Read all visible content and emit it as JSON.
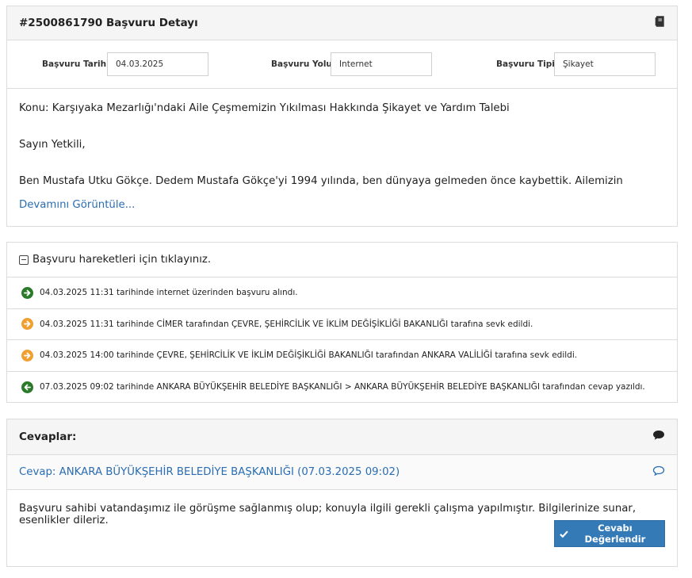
{
  "detail": {
    "title": "#2500861790 Başvuru Detayı",
    "fields": [
      {
        "label": "Başvuru Tarihi:",
        "value": "04.03.2025"
      },
      {
        "label": "Başvuru Yolu:",
        "value": "İnternet"
      },
      {
        "label": "Başvuru Tipi:",
        "value": "Şikayet"
      }
    ],
    "subject": "Konu: Karşıyaka Mezarlığı'ndaki Aile Çeşmemizin Yıkılması Hakkında Şikayet ve Yardım Talebi",
    "greeting": "Sayın Yetkili,",
    "body": "Ben Mustafa Utku Gökçe. Dedem Mustafa Gökçe'yi 1994 yılında, ben dünyaya gelmeden önce kaybettik. Ailemizin büyüklerinden halam Fahriye Gökçe de bu acıyı yaşamış ve aile çeşmemizin onarılmasını Karşıyaka Mezarlığı'nda istedik.",
    "more_link": "Devamını Görüntüle..."
  },
  "history": {
    "toggle_label": "Başvuru hareketleri için tıklayınız.",
    "items": [
      {
        "text": "04.03.2025 11:31 tarihinde internet üzerinden başvuru alındı.",
        "icon": "arrow-right-circle-icon",
        "color": "#2a7a2a"
      },
      {
        "text": "04.03.2025 11:31 tarihinde CİMER tarafından ÇEVRE, ŞEHİRCİLİK VE İKLİM DEĞİŞİKLİĞİ BAKANLIĞI tarafına sevk edildi.",
        "icon": "arrow-right-circle-icon",
        "color": "#f0a030"
      },
      {
        "text": "04.03.2025 14:00 tarihinde ÇEVRE, ŞEHİRCİLİK VE İKLİM DEĞİŞİKLİĞİ BAKANLIĞI tarafından ANKARA VALİLİĞİ tarafına sevk edildi.",
        "icon": "arrow-right-circle-icon",
        "color": "#f0a030"
      },
      {
        "text": "07.03.2025 09:02 tarihinde ANKARA BÜYÜKŞEHİR BELEDİYE BAŞKANLIĞI > ANKARA BÜYÜKŞEHİR BELEDİYE BAŞKANLIĞI tarafından cevap yazıldı.",
        "icon": "arrow-left-circle-icon",
        "color": "#2a7a2a"
      }
    ]
  },
  "answers": {
    "title": "Cevaplar:",
    "reply_title": "Cevap: ANKARA BÜYÜKŞEHİR BELEDİYE BAŞKANLIĞI (07.03.2025 09:02)",
    "reply_body": "Başvuru sahibi vatandaşımız ile görüşme sağlanmış olup; konuyla ilgili gerekli çalışma yapılmıştır. Bilgilerinize sunar, esenlikler dileriz.",
    "rate_button": "Cevabı Değerlendir"
  },
  "colors": {
    "link": "#2a6db3",
    "button": "#337ab7"
  }
}
